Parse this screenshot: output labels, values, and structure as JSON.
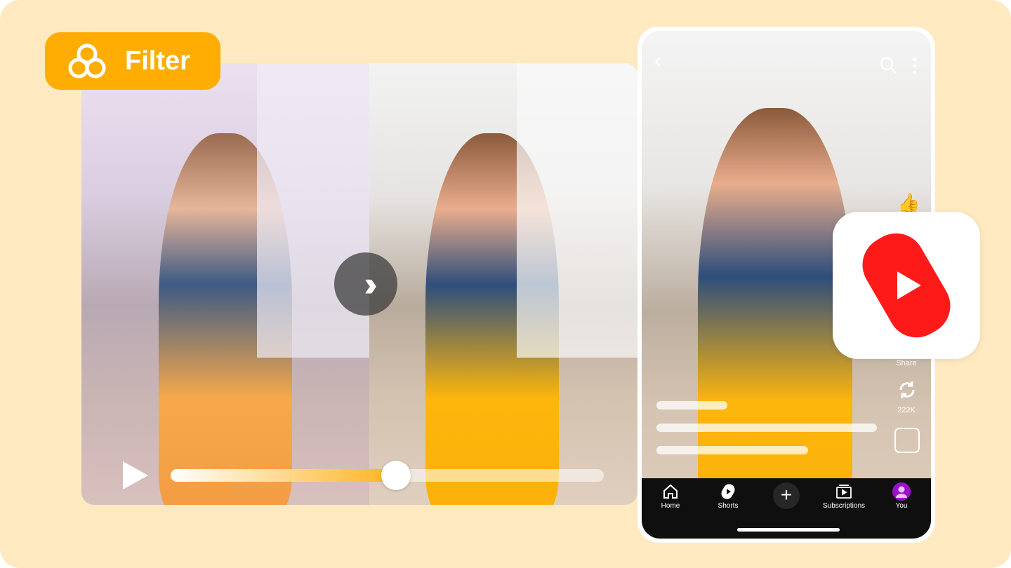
{
  "badge": {
    "label": "Filter",
    "icon": "three-circles-filter-icon",
    "color": "#ffad02"
  },
  "editor": {
    "compare_icon": "double-chevron-right-icon",
    "progress_percent": 52,
    "accent": "#ffb31f"
  },
  "phone": {
    "top_icons": [
      "back-icon",
      "search-icon",
      "more-vertical-icon"
    ],
    "actions": {
      "share_label": "Share",
      "remix_count": "222K"
    },
    "nav": [
      {
        "label": "Home",
        "icon": "home-icon"
      },
      {
        "label": "Shorts",
        "icon": "shorts-icon"
      },
      {
        "label": "",
        "icon": "create-plus-icon"
      },
      {
        "label": "Subscriptions",
        "icon": "subscriptions-icon"
      },
      {
        "label": "You",
        "icon": "avatar-icon"
      }
    ]
  },
  "logo": {
    "name": "YouTube Shorts",
    "color": "#ff0000"
  }
}
